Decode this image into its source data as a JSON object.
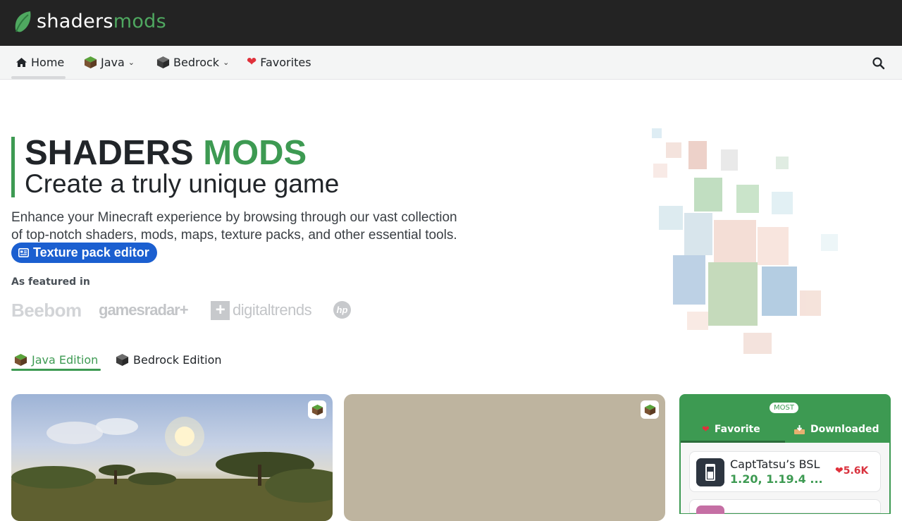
{
  "brand": {
    "word1": "shaders",
    "word2": "mods"
  },
  "nav": {
    "home": "Home",
    "java": "Java",
    "bedrock": "Bedrock",
    "favorites": "Favorites"
  },
  "hero": {
    "title_part1": "SHADERS",
    "title_part2": "MODS",
    "subtitle": "Create a truly unique game",
    "description": "Enhance your Minecraft experience by browsing through our vast collection of top-notch shaders, mods, maps, texture packs, and other essential tools.",
    "cta": "Texture pack editor"
  },
  "featured": {
    "label": "As featured in",
    "logos": [
      "Beebom",
      "gamesradar+",
      "digitaltrends",
      "hp"
    ]
  },
  "edition_tabs": {
    "java": "Java Edition",
    "bedrock": "Bedrock Edition"
  },
  "most": {
    "pill": "MOST",
    "tab_favorite": "Favorite",
    "tab_downloaded": "Downloaded",
    "item": {
      "name": "CaptTatsu’s BSL",
      "versions": "1.20, 1.19.4 ...",
      "likes": "5.6K"
    }
  },
  "colors": {
    "accent": "#3d9a52",
    "header": "#232323",
    "cta": "#1b5fd0",
    "like": "#d9333f"
  },
  "icons": [
    "leaf-logo-icon",
    "home-icon",
    "grass-block-icon",
    "bedrock-block-icon",
    "heart-icon",
    "search-icon",
    "editor-icon",
    "download-icon"
  ]
}
